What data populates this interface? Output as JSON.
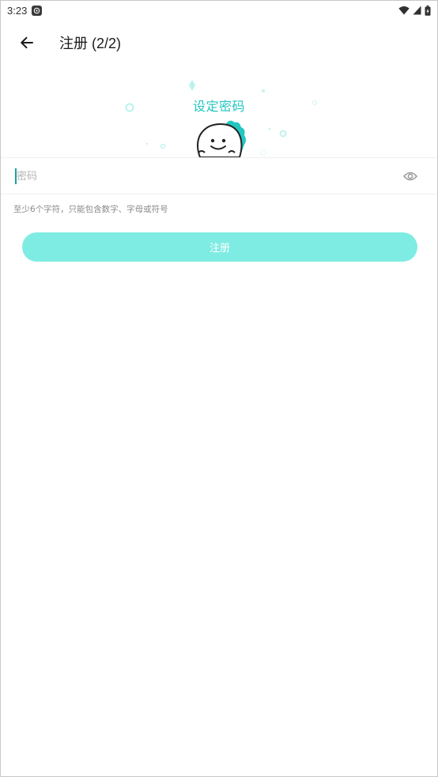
{
  "status_bar": {
    "time": "3:23",
    "icons": [
      "wifi-icon",
      "signal-icon",
      "battery-icon"
    ]
  },
  "app_bar": {
    "title": "注册 (2/2)",
    "back_icon": "arrow-left-icon"
  },
  "header": {
    "title": "设定密码",
    "mascot": "dino-mascot"
  },
  "password_field": {
    "placeholder": "密码",
    "value": "",
    "toggle_icon": "eye-icon"
  },
  "hint": "至少6个字符，只能包含数字、字母或符号",
  "register_button": {
    "label": "注册"
  },
  "colors": {
    "accent": "#22c7c0",
    "button_disabled": "#7fece3",
    "hint": "#8a8a8a"
  }
}
